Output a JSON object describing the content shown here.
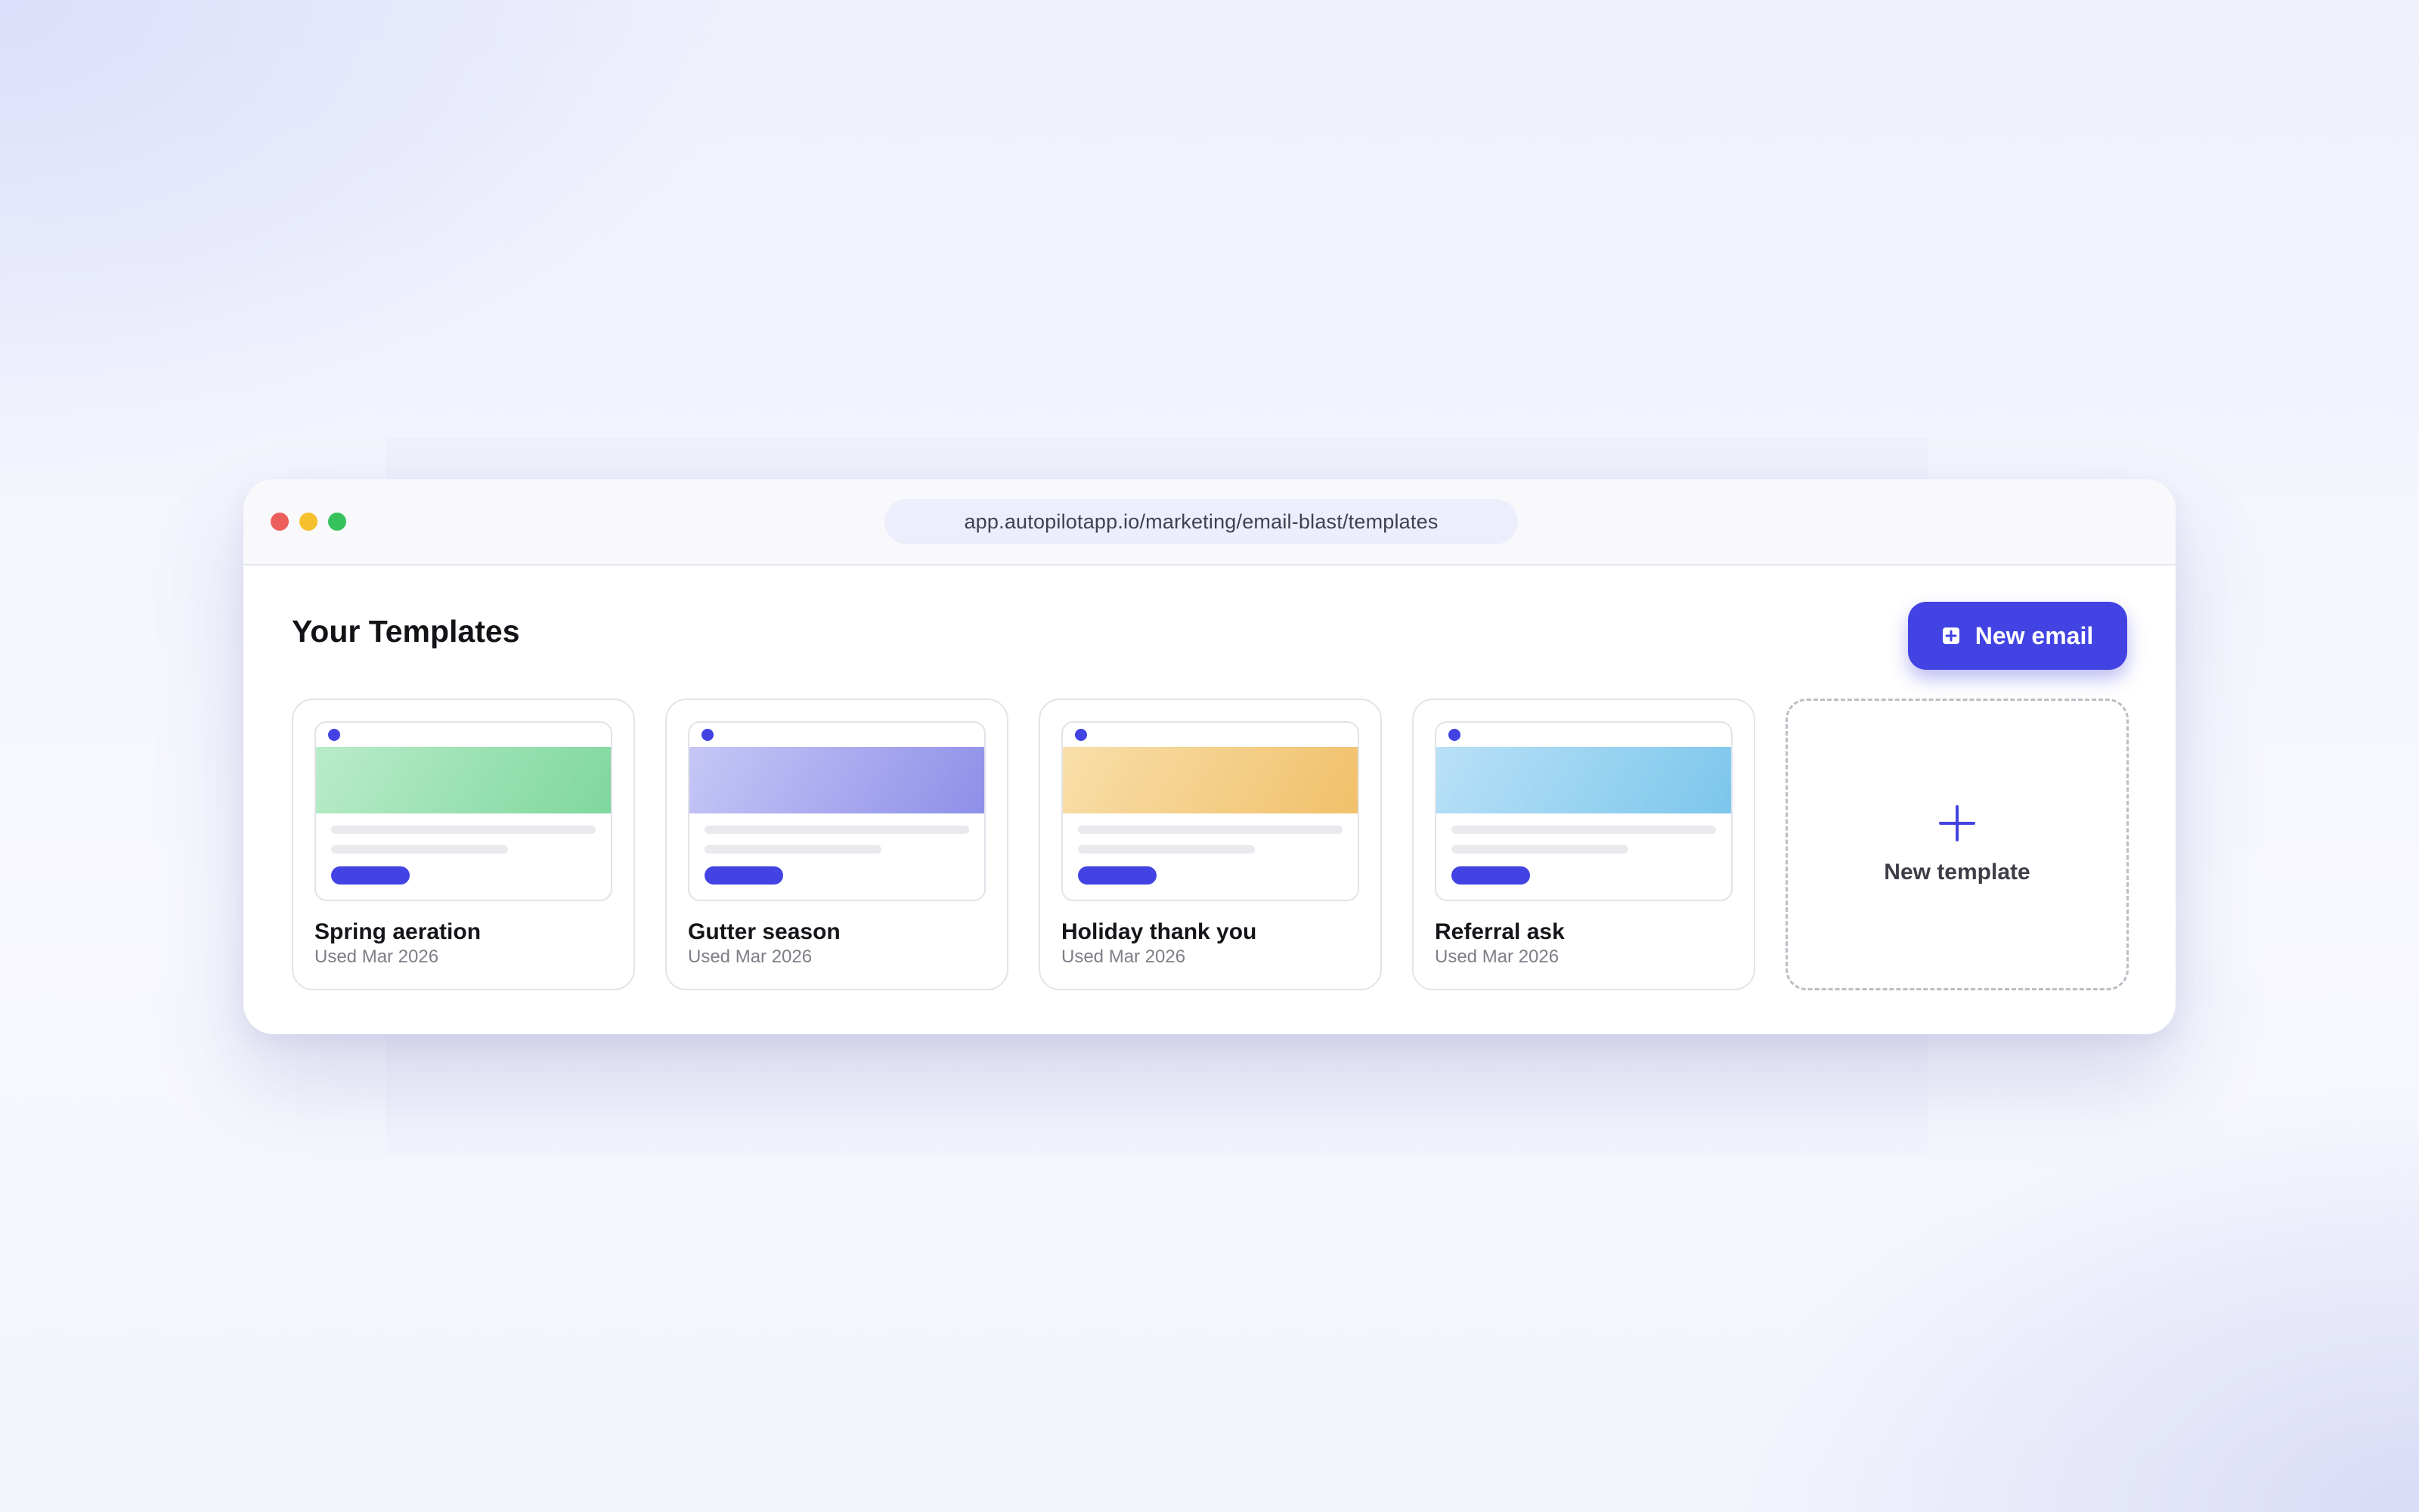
{
  "browser": {
    "url": "app.autopilotapp.io/marketing/email-blast/templates"
  },
  "page": {
    "title": "Your Templates",
    "new_email_label": "New email",
    "new_email_icon": "plus-square-icon",
    "accent_color": "#4243e2"
  },
  "templates": [
    {
      "name": "Spring aeration",
      "meta": "Used Mar 2026",
      "banner_colors": [
        "#b9ecc9",
        "#7fd79d"
      ]
    },
    {
      "name": "Gutter season",
      "meta": "Used Mar 2026",
      "banner_colors": [
        "#c6c7f6",
        "#8e8fe8"
      ]
    },
    {
      "name": "Holiday thank you",
      "meta": "Used Mar 2026",
      "banner_colors": [
        "#f8dfaa",
        "#f1c06a"
      ]
    },
    {
      "name": "Referral ask",
      "meta": "Used Mar 2026",
      "banner_colors": [
        "#b9e1f7",
        "#7cc6ec"
      ]
    }
  ],
  "new_template": {
    "label": "New template",
    "icon": "plus-icon"
  }
}
